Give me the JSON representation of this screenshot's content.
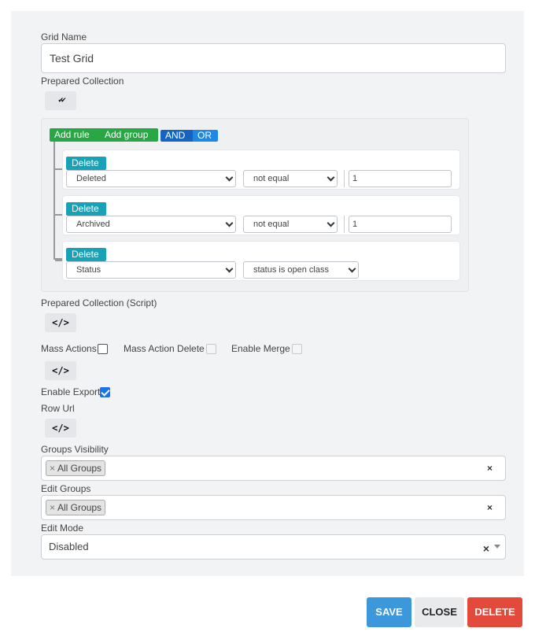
{
  "form": {
    "grid_name_label": "Grid Name",
    "grid_name_value": "Test Grid",
    "prepared_collection_label": "Prepared Collection",
    "prepared_collection_icon": "double-check-icon",
    "prepared_collection_script_label": "Prepared Collection (Script)",
    "mass_actions_label": "Mass Actions",
    "mass_action_delete_label": "Mass Action Delete",
    "enable_merge_label": "Enable Merge",
    "enable_export_label": "Enable Export",
    "row_url_label": "Row Url",
    "groups_visibility_label": "Groups Visibility",
    "groups_visibility_tag": "All Groups",
    "edit_groups_label": "Edit Groups",
    "edit_groups_tag": "All Groups",
    "edit_mode_label": "Edit Mode",
    "edit_mode_value": "Disabled",
    "code_icon_glyph": "</>",
    "check_icon_glyph": "✔✔"
  },
  "query_builder": {
    "add_rule_label": "Add rule",
    "add_group_label": "Add group",
    "and_label": "AND",
    "or_label": "OR",
    "rules": [
      {
        "delete_label": "Delete",
        "field": "Deleted",
        "operator": "not equal",
        "value": "1"
      },
      {
        "delete_label": "Delete",
        "field": "Archived",
        "operator": "not equal",
        "value": "1"
      },
      {
        "delete_label": "Delete",
        "field": "Status",
        "operator": "status is open class",
        "value": ""
      }
    ]
  },
  "checkboxes": {
    "mass_actions": false,
    "mass_action_delete": false,
    "enable_merge": false,
    "enable_export": true
  },
  "footer": {
    "save_label": "SAVE",
    "close_label": "CLOSE",
    "delete_label": "DELETE"
  },
  "colors": {
    "save": "#3c97db",
    "close": "#e9eaec",
    "delete": "#e34a3b",
    "green": "#28a745",
    "teal": "#17a2b8",
    "and_blue": "#1565c0",
    "or_blue": "#1e88e5"
  },
  "clear_glyph": "×"
}
